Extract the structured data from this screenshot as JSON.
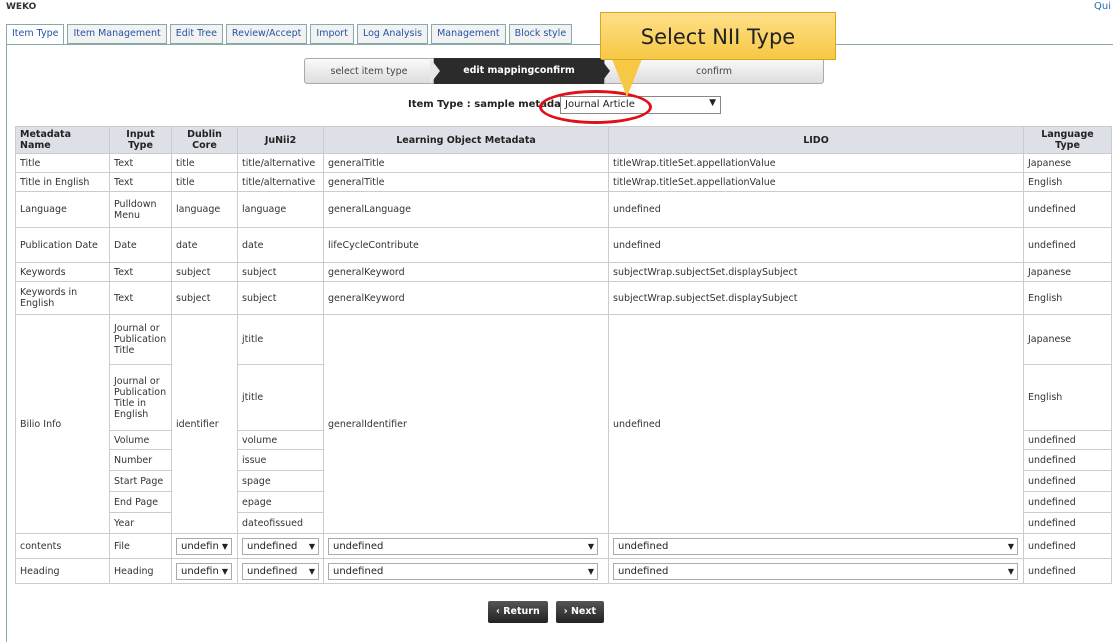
{
  "app": {
    "title": "WEKO",
    "quick": "Qui"
  },
  "tabs": [
    "Item Type",
    "Item Management",
    "Edit Tree",
    "Review/Accept",
    "Import",
    "Log Analysis",
    "Management",
    "Block style"
  ],
  "steps": [
    "select item type",
    "edit mappingconfirm",
    "confirm"
  ],
  "callout": "Select NII Type",
  "item_type": {
    "label": "Item Type : sample metadata",
    "selected": "Journal Article"
  },
  "columns": [
    "Metadata Name",
    "Input Type",
    "Dublin Core",
    "JuNii2",
    "Learning Object Metadata",
    "LIDO",
    "Language Type"
  ],
  "rows": [
    {
      "name": "Title",
      "input": "Text",
      "dc": "title",
      "junii2": "title/alternative",
      "lom": "generalTitle",
      "lido": "titleWrap.titleSet.appellationValue",
      "lang": "Japanese"
    },
    {
      "name": "Title in English",
      "input": "Text",
      "dc": "title",
      "junii2": "title/alternative",
      "lom": "generalTitle",
      "lido": "titleWrap.titleSet.appellationValue",
      "lang": "English"
    },
    {
      "name": "Language",
      "input": "Pulldown Menu",
      "dc": "language",
      "junii2": "language",
      "lom": "generalLanguage",
      "lido": "undefined",
      "lang": "undefined"
    },
    {
      "name": "Publication Date",
      "input": "Date",
      "dc": "date",
      "junii2": "date",
      "lom": "lifeCycleContribute",
      "lido": "undefined",
      "lang": "undefined"
    },
    {
      "name": "Keywords",
      "input": "Text",
      "dc": "subject",
      "junii2": "subject",
      "lom": "generalKeyword",
      "lido": "subjectWrap.subjectSet.displaySubject",
      "lang": "Japanese"
    },
    {
      "name": "Keywords in English",
      "input": "Text",
      "dc": "subject",
      "junii2": "subject",
      "lom": "generalKeyword",
      "lido": "subjectWrap.subjectSet.displaySubject",
      "lang": "English"
    }
  ],
  "biblio": {
    "name": "Bilio Info",
    "dc": "identifier",
    "lom": "generalIdentifier",
    "lido": "undefined",
    "items": [
      {
        "input": "Journal or Publication Title",
        "junii2": "jtitle",
        "lang": "Japanese"
      },
      {
        "input": "Journal or Publication Title in English",
        "junii2": "jtitle",
        "lang": "English"
      },
      {
        "input": "Volume",
        "junii2": "volume",
        "lang": "undefined"
      },
      {
        "input": "Number",
        "junii2": "issue",
        "lang": "undefined"
      },
      {
        "input": "Start Page",
        "junii2": "spage",
        "lang": "undefined"
      },
      {
        "input": "End Page",
        "junii2": "epage",
        "lang": "undefined"
      },
      {
        "input": "Year",
        "junii2": "dateofissued",
        "lang": "undefined"
      }
    ]
  },
  "select_rows": [
    {
      "name": "contents",
      "input": "File",
      "dc": "undefin",
      "junii2": "undefined",
      "lom": "undefined",
      "lido": "undefined",
      "lang": "undefined"
    },
    {
      "name": "Heading",
      "input": "Heading",
      "dc": "undefin",
      "junii2": "undefined",
      "lom": "undefined",
      "lido": "undefined",
      "lang": "undefined"
    }
  ],
  "buttons": {
    "return": "‹ Return",
    "next": "› Next"
  }
}
